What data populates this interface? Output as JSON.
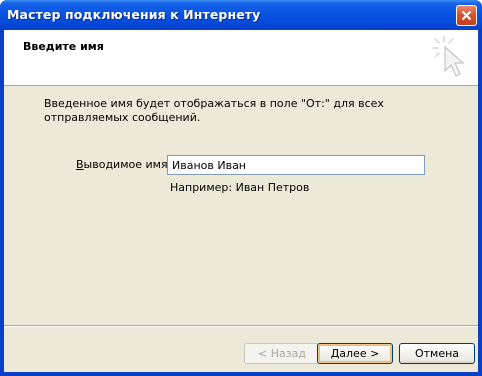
{
  "window": {
    "title": "Мастер подключения к Интернету"
  },
  "header": {
    "title": "Введите имя"
  },
  "main": {
    "intro_text": "Введенное имя будет отображаться в поле \"От:\" для всех отправляемых сообщений.",
    "display_name": {
      "label": "Выводимое имя:",
      "value": "Иванов Иван"
    },
    "example_text": "Например: Иван Петров"
  },
  "buttons": {
    "back_label": "< Назад",
    "next_label": "Далее >",
    "cancel_label": "Отмена"
  },
  "icons": {
    "close": "close-icon",
    "wizard": "wizard-sparkle-cursor-icon"
  },
  "colors": {
    "titlebar": "#0a54e3",
    "close_button": "#d9532e",
    "dialog_face": "#ece9d8"
  }
}
